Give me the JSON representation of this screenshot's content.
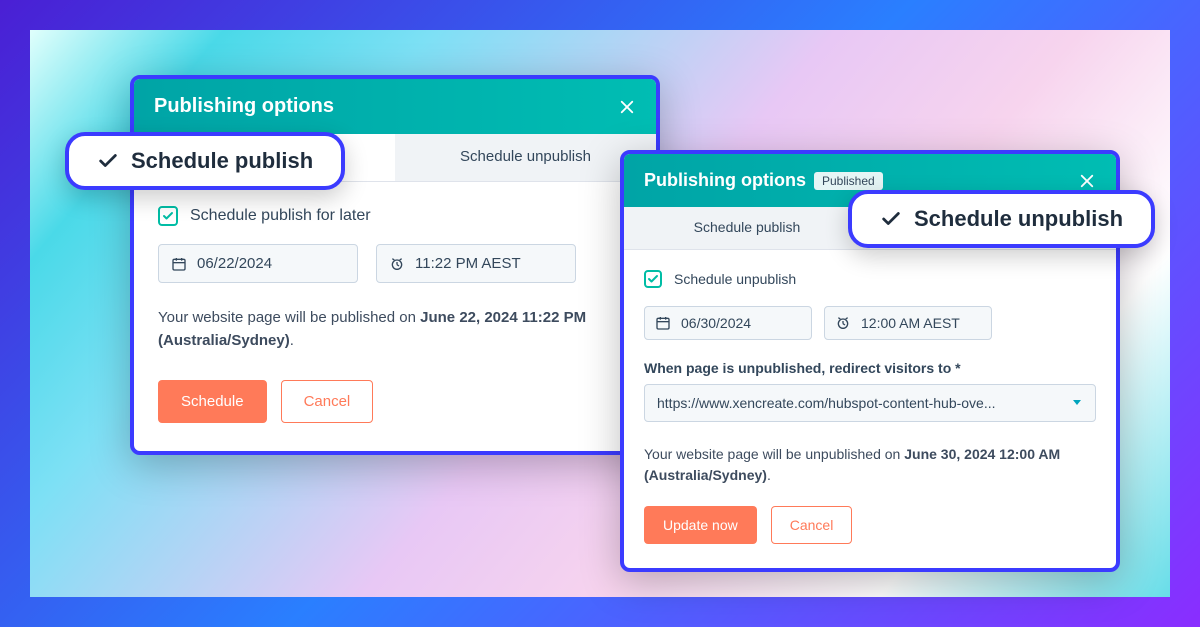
{
  "callouts": {
    "publish": "Schedule publish",
    "unpublish": "Schedule unpublish"
  },
  "modal1": {
    "title": "Publishing options",
    "tabs": {
      "publish": "Schedule publish",
      "unpublish": "Schedule unpublish"
    },
    "checkbox_label": "Schedule publish for later",
    "date": "06/22/2024",
    "time": "11:22 PM AEST",
    "explain_pre": "Your website page will be published on ",
    "explain_bold": "June 22, 2024 11:22 PM (Australia/Sydney)",
    "explain_post": ".",
    "primary": "Schedule",
    "secondary": "Cancel"
  },
  "modal2": {
    "title": "Publishing options",
    "badge": "Published",
    "tabs": {
      "publish": "Schedule publish",
      "unpublish": "Schedule unpublish"
    },
    "checkbox_label": "Schedule unpublish",
    "date": "06/30/2024",
    "time": "12:00 AM AEST",
    "redirect_label": "When page is unpublished, redirect visitors to *",
    "redirect_value": "https://www.xencreate.com/hubspot-content-hub-ove...",
    "explain_pre": "Your website page will be unpublished on ",
    "explain_bold": "June 30, 2024 12:00 AM (Australia/Sydney)",
    "explain_post": ".",
    "primary": "Update now",
    "secondary": "Cancel"
  }
}
